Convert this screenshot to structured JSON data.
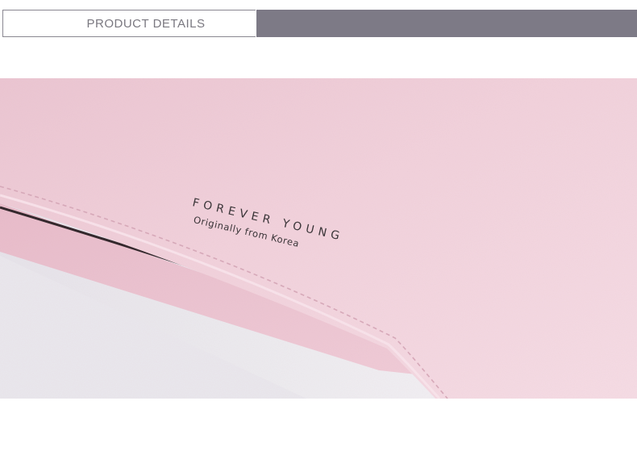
{
  "header": {
    "title": "PRODUCT DETAILS"
  },
  "photo": {
    "subject": "pink-leather-wallet-closeup",
    "brand_line": "FOREVER YOUNG",
    "sub_line": "Originally from Korea"
  },
  "colors": {
    "header_fill": "#7d7a86",
    "header_text": "#7a7880",
    "leather_pink": "#f0cfd9",
    "leather_edge": "#3a2b30"
  }
}
